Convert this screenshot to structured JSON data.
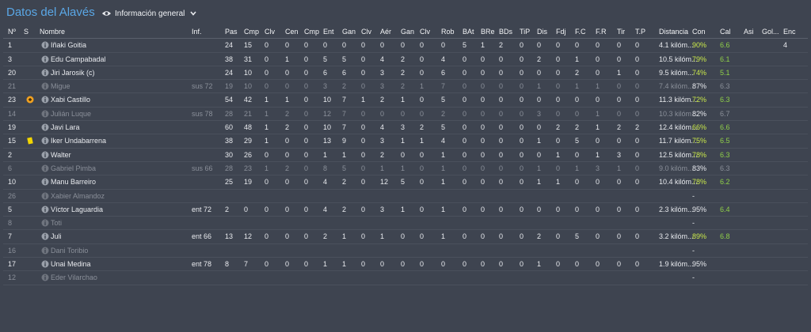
{
  "header": {
    "title": "Datos del Alavés",
    "view_label": "Información general"
  },
  "colors": {
    "background": "#3e4450",
    "title": "#5aa7e6",
    "good": "#c9e84a",
    "rating": "#8fcf48",
    "dim": "#8a8f99"
  },
  "columns": [
    "Nº",
    "S",
    "Nombre",
    "Inf.",
    "Pas",
    "Cmp",
    "Clv",
    "Cen",
    "Cmp",
    "Ent",
    "Gan",
    "Clv",
    "Aér",
    "Gan",
    "Clv",
    "Rob",
    "BAt",
    "BRe",
    "BDs",
    "TiP",
    "Dis",
    "Fdj",
    "F.C",
    "F.R",
    "Tir",
    "T.P",
    "Distancia",
    "Con",
    "Cal",
    "Asi",
    "Gol...",
    "Enc"
  ],
  "rows": [
    {
      "num": "1",
      "status": "",
      "name": "Iñaki Goitia",
      "inf": "",
      "dim": false,
      "stats": [
        "24",
        "15",
        "0",
        "0",
        "0",
        "0",
        "0",
        "0",
        "0",
        "0",
        "0",
        "0",
        "5",
        "1",
        "2",
        "0",
        "0",
        "0",
        "0",
        "0",
        "0",
        "0"
      ],
      "dist": "4.1 kilóm...",
      "con": "90%",
      "cal": "6.6",
      "asi": "",
      "gol": "",
      "enc": "4"
    },
    {
      "num": "3",
      "status": "",
      "name": "Edu Campabadal",
      "inf": "",
      "dim": false,
      "stats": [
        "38",
        "31",
        "0",
        "1",
        "0",
        "5",
        "5",
        "0",
        "4",
        "2",
        "0",
        "4",
        "0",
        "0",
        "0",
        "0",
        "2",
        "0",
        "1",
        "0",
        "0",
        "0"
      ],
      "dist": "10.5 kilóm...",
      "con": "79%",
      "cal": "6.1",
      "asi": "",
      "gol": "",
      "enc": ""
    },
    {
      "num": "20",
      "status": "",
      "name": "Jiri Jarosik (c)",
      "inf": "",
      "dim": false,
      "stats": [
        "24",
        "10",
        "0",
        "0",
        "0",
        "6",
        "6",
        "0",
        "3",
        "2",
        "0",
        "6",
        "0",
        "0",
        "0",
        "0",
        "0",
        "0",
        "2",
        "0",
        "1",
        "0"
      ],
      "dist": "9.5 kilóm...",
      "con": "74%",
      "cal": "5.1",
      "asi": "",
      "gol": "",
      "enc": ""
    },
    {
      "num": "21",
      "status": "",
      "name": "Migue",
      "inf": "sus 72",
      "dim": true,
      "stats": [
        "19",
        "10",
        "0",
        "0",
        "0",
        "3",
        "2",
        "0",
        "3",
        "2",
        "1",
        "7",
        "0",
        "0",
        "0",
        "0",
        "1",
        "0",
        "1",
        "1",
        "0",
        "0"
      ],
      "dist": "7.4 kilóm...",
      "con": "87%",
      "cal": "6.3",
      "asi": "",
      "gol": "",
      "enc": ""
    },
    {
      "num": "23",
      "status": "sub",
      "name": "Xabi Castillo",
      "inf": "",
      "dim": false,
      "stats": [
        "54",
        "42",
        "1",
        "1",
        "0",
        "10",
        "7",
        "1",
        "2",
        "1",
        "0",
        "5",
        "0",
        "0",
        "0",
        "0",
        "0",
        "0",
        "0",
        "0",
        "0",
        "0"
      ],
      "dist": "11.3 kilóm...",
      "con": "72%",
      "cal": "6.3",
      "asi": "",
      "gol": "",
      "enc": ""
    },
    {
      "num": "14",
      "status": "",
      "name": "Julián Luque",
      "inf": "sus 78",
      "dim": true,
      "stats": [
        "28",
        "21",
        "1",
        "2",
        "0",
        "12",
        "7",
        "0",
        "0",
        "0",
        "0",
        "2",
        "0",
        "0",
        "0",
        "0",
        "3",
        "0",
        "0",
        "1",
        "0",
        "0"
      ],
      "dist": "10.3 kilóm...",
      "con": "82%",
      "cal": "6.7",
      "asi": "",
      "gol": "",
      "enc": ""
    },
    {
      "num": "19",
      "status": "",
      "name": "Javi Lara",
      "inf": "",
      "dim": false,
      "stats": [
        "60",
        "48",
        "1",
        "2",
        "0",
        "10",
        "7",
        "0",
        "4",
        "3",
        "2",
        "5",
        "0",
        "0",
        "0",
        "0",
        "0",
        "2",
        "2",
        "1",
        "2",
        "2"
      ],
      "dist": "12.4 kilóm...",
      "con": "66%",
      "cal": "6.6",
      "asi": "",
      "gol": "",
      "enc": ""
    },
    {
      "num": "15",
      "status": "yellow",
      "name": "Iker Undabarrena",
      "inf": "",
      "dim": false,
      "stats": [
        "38",
        "29",
        "1",
        "0",
        "0",
        "13",
        "9",
        "0",
        "3",
        "1",
        "1",
        "4",
        "0",
        "0",
        "0",
        "0",
        "1",
        "0",
        "5",
        "0",
        "0",
        "0"
      ],
      "dist": "11.7 kilóm...",
      "con": "75%",
      "cal": "6.5",
      "asi": "",
      "gol": "",
      "enc": ""
    },
    {
      "num": "2",
      "status": "",
      "name": "Walter",
      "inf": "",
      "dim": false,
      "stats": [
        "30",
        "26",
        "0",
        "0",
        "0",
        "1",
        "1",
        "0",
        "2",
        "0",
        "0",
        "1",
        "0",
        "0",
        "0",
        "0",
        "0",
        "1",
        "0",
        "1",
        "3",
        "0"
      ],
      "dist": "12.5 kilóm...",
      "con": "78%",
      "cal": "6.3",
      "asi": "",
      "gol": "",
      "enc": ""
    },
    {
      "num": "6",
      "status": "",
      "name": "Gabriel Pimba",
      "inf": "sus 66",
      "dim": true,
      "stats": [
        "28",
        "23",
        "1",
        "2",
        "0",
        "8",
        "5",
        "0",
        "1",
        "1",
        "0",
        "1",
        "0",
        "0",
        "0",
        "0",
        "1",
        "0",
        "1",
        "3",
        "1",
        "0"
      ],
      "dist": "9.0 kilóm...",
      "con": "83%",
      "cal": "6.3",
      "asi": "",
      "gol": "",
      "enc": ""
    },
    {
      "num": "10",
      "status": "",
      "name": "Manu Barreiro",
      "inf": "",
      "dim": false,
      "stats": [
        "25",
        "19",
        "0",
        "0",
        "0",
        "4",
        "2",
        "0",
        "12",
        "5",
        "0",
        "1",
        "0",
        "0",
        "0",
        "0",
        "1",
        "1",
        "0",
        "0",
        "0",
        "0"
      ],
      "dist": "10.4 kilóm...",
      "con": "78%",
      "cal": "6.2",
      "asi": "",
      "gol": "",
      "enc": ""
    },
    {
      "num": "26",
      "status": "",
      "name": "Xabier Almandoz",
      "inf": "",
      "dim": true,
      "stats": [
        "",
        "",
        "",
        "",
        "",
        "",
        "",
        "",
        "",
        "",
        "",
        "",
        "",
        "",
        "",
        "",
        "",
        "",
        "",
        "",
        "",
        ""
      ],
      "dist": "",
      "con": "-",
      "cal": "",
      "asi": "",
      "gol": "",
      "enc": ""
    },
    {
      "num": "5",
      "status": "",
      "name": "Víctor Laguardia",
      "inf": "ent 72",
      "dim": false,
      "stats": [
        "2",
        "0",
        "0",
        "0",
        "0",
        "4",
        "2",
        "0",
        "3",
        "1",
        "0",
        "1",
        "0",
        "0",
        "0",
        "0",
        "0",
        "0",
        "0",
        "0",
        "0",
        "0"
      ],
      "dist": "2.3 kilóm...",
      "con": "95%",
      "cal": "6.4",
      "asi": "",
      "gol": "",
      "enc": ""
    },
    {
      "num": "8",
      "status": "",
      "name": "Toti",
      "inf": "",
      "dim": true,
      "stats": [
        "",
        "",
        "",
        "",
        "",
        "",
        "",
        "",
        "",
        "",
        "",
        "",
        "",
        "",
        "",
        "",
        "",
        "",
        "",
        "",
        "",
        ""
      ],
      "dist": "",
      "con": "-",
      "cal": "",
      "asi": "",
      "gol": "",
      "enc": ""
    },
    {
      "num": "7",
      "status": "",
      "name": "Juli",
      "inf": "ent 66",
      "dim": false,
      "stats": [
        "13",
        "12",
        "0",
        "0",
        "0",
        "2",
        "1",
        "0",
        "1",
        "0",
        "0",
        "1",
        "0",
        "0",
        "0",
        "0",
        "2",
        "0",
        "5",
        "0",
        "0",
        "0"
      ],
      "dist": "3.2 kilóm...",
      "con": "89%",
      "cal": "6.8",
      "asi": "",
      "gol": "",
      "enc": ""
    },
    {
      "num": "16",
      "status": "",
      "name": "Dani Toribio",
      "inf": "",
      "dim": true,
      "stats": [
        "",
        "",
        "",
        "",
        "",
        "",
        "",
        "",
        "",
        "",
        "",
        "",
        "",
        "",
        "",
        "",
        "",
        "",
        "",
        "",
        "",
        ""
      ],
      "dist": "",
      "con": "-",
      "cal": "",
      "asi": "",
      "gol": "",
      "enc": ""
    },
    {
      "num": "17",
      "status": "",
      "name": "Unai Medina",
      "inf": "ent 78",
      "dim": false,
      "stats": [
        "8",
        "7",
        "0",
        "0",
        "0",
        "1",
        "1",
        "0",
        "0",
        "0",
        "0",
        "0",
        "0",
        "0",
        "0",
        "0",
        "1",
        "0",
        "0",
        "0",
        "0",
        "0"
      ],
      "dist": "1.9 kilóm...",
      "con": "95%",
      "cal": "",
      "asi": "",
      "gol": "",
      "enc": ""
    },
    {
      "num": "12",
      "status": "",
      "name": "Eder Vilarchao",
      "inf": "",
      "dim": true,
      "stats": [
        "",
        "",
        "",
        "",
        "",
        "",
        "",
        "",
        "",
        "",
        "",
        "",
        "",
        "",
        "",
        "",
        "",
        "",
        "",
        "",
        "",
        ""
      ],
      "dist": "",
      "con": "-",
      "cal": "",
      "asi": "",
      "gol": "",
      "enc": ""
    }
  ]
}
